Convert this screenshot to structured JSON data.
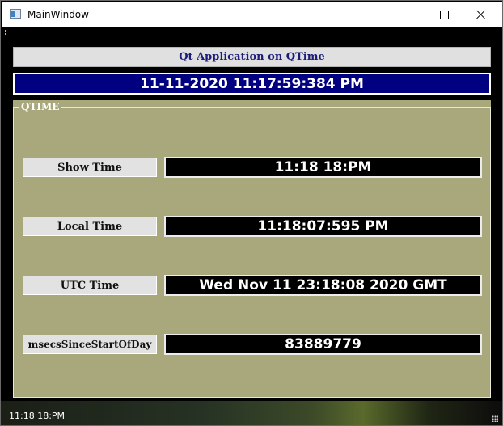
{
  "window": {
    "title": "MainWindow"
  },
  "header": {
    "title": "Qt Application on QTime",
    "datetime": "11-11-2020 11:17:59:384 PM"
  },
  "group": {
    "title": "QTIME",
    "rows": [
      {
        "label": "Show Time",
        "value": "11:18 18:PM"
      },
      {
        "label": "Local Time",
        "value": "11:18:07:595 PM"
      },
      {
        "label": "UTC Time",
        "value": "Wed Nov 11 23:18:08 2020 GMT"
      },
      {
        "label": "msecsSinceStartOfDay",
        "value": "83889779"
      }
    ]
  },
  "statusbar": {
    "text": "11:18 18:PM"
  },
  "colors": {
    "group_background": "#a8a87c",
    "date_bar_background": "#000080",
    "header_text": "#1c1c7a",
    "window_background": "#000000"
  }
}
